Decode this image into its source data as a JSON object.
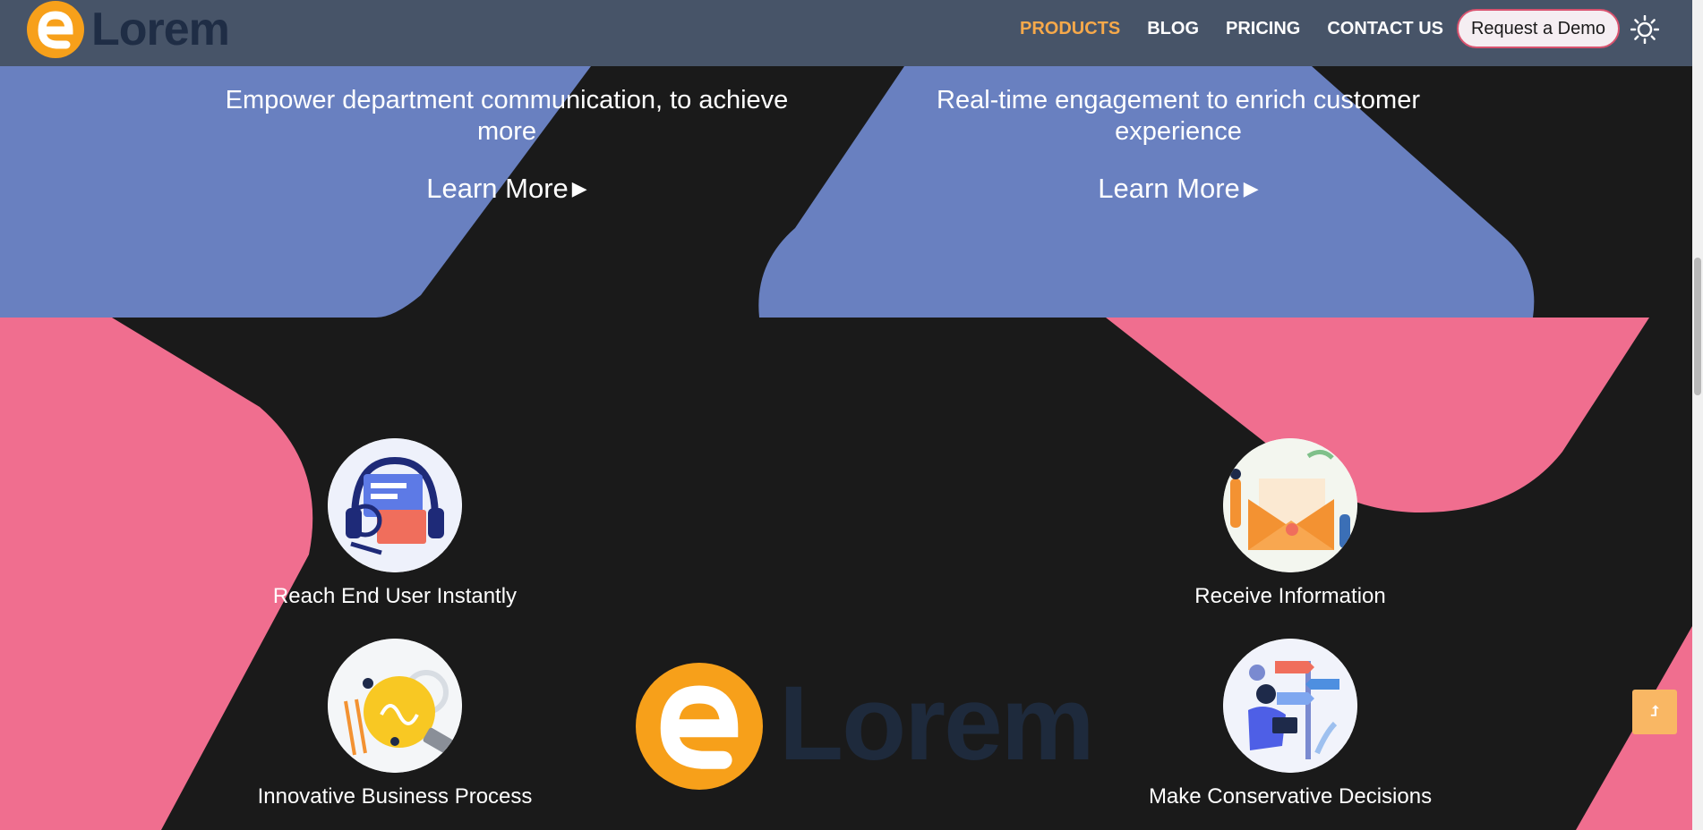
{
  "brand": {
    "name": "Lorem",
    "accent": "#f7a01a"
  },
  "nav": {
    "links": [
      {
        "label": "PRODUCTS",
        "active": true
      },
      {
        "label": "BLOG"
      },
      {
        "label": "PRICING"
      },
      {
        "label": "CONTACT US"
      }
    ],
    "demo_button": "Request a Demo",
    "theme_icon": "sun-icon"
  },
  "hero": {
    "left": {
      "tagline": "Empower department communication, to achieve more",
      "link": "Learn More"
    },
    "right": {
      "tagline": "Real-time engagement to enrich customer experience",
      "link": "Learn More"
    }
  },
  "features": [
    {
      "label": "Reach End User Instantly",
      "icon": "customer-support-illustration"
    },
    {
      "label": "Receive Information",
      "icon": "envelope-illustration"
    },
    {
      "label": "Innovative Business Process",
      "icon": "lightbulb-illustration"
    },
    {
      "label": "Make Conservative Decisions",
      "icon": "signpost-illustration"
    }
  ],
  "footer_logo": {
    "name": "Lorem"
  },
  "scroll_top_icon": "arrow-up-icon",
  "colors": {
    "blue": "#6980c0",
    "pink": "#f06e8f",
    "background": "#1a1a1a",
    "nav": "#475468"
  }
}
